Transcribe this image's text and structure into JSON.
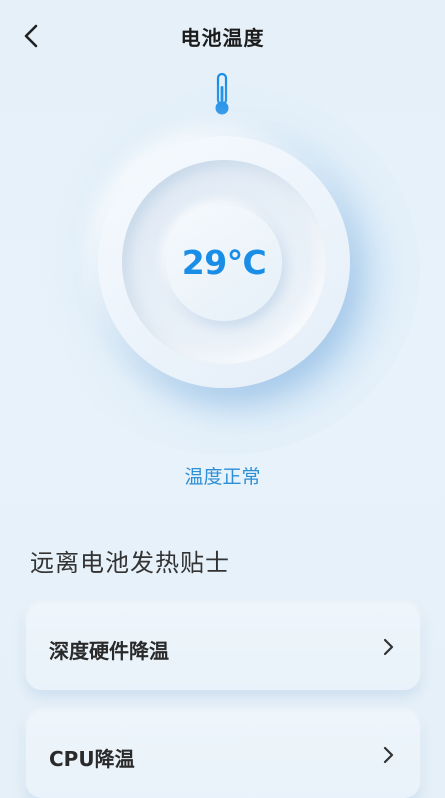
{
  "header": {
    "title": "电池温度",
    "back_icon": "chevron-left-icon"
  },
  "thermometer": {
    "icon": "thermometer-icon",
    "color": "#1a8ee6"
  },
  "dial": {
    "temperature": "29℃",
    "status": "温度正常",
    "accent": "#1a8ee6"
  },
  "tips": {
    "title": "远离电池发热贴士",
    "items": [
      {
        "label": "深度硬件降温",
        "icon": "chevron-right-icon"
      },
      {
        "label": "CPU降温",
        "icon": "chevron-right-icon"
      }
    ]
  }
}
